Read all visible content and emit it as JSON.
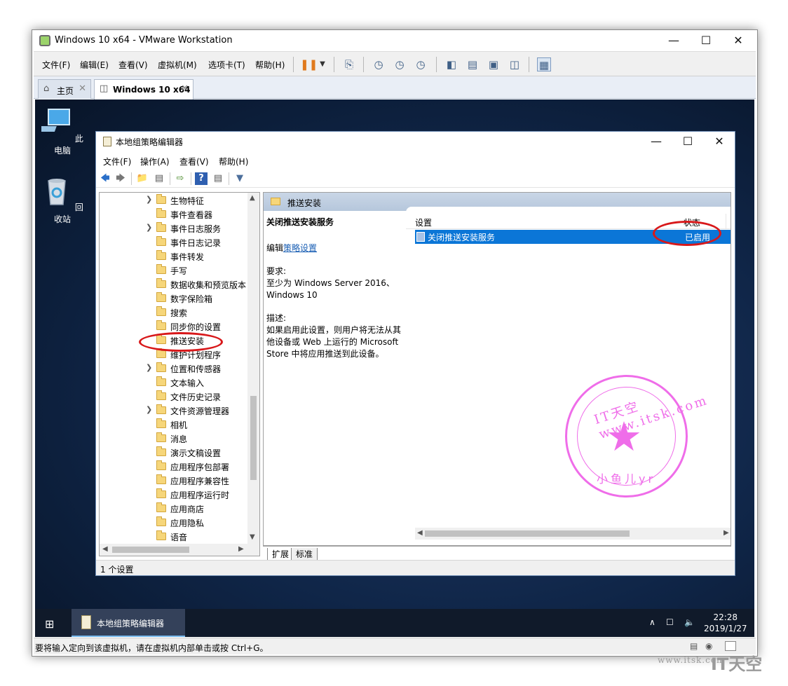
{
  "vmware": {
    "title": "Windows 10 x64 - VMware Workstation",
    "menus": [
      "文件(F)",
      "编辑(E)",
      "查看(V)",
      "虚拟机(M)",
      "选项卡(T)",
      "帮助(H)"
    ],
    "tabs": [
      {
        "label": "主页",
        "icon": "home-icon"
      },
      {
        "label": "Windows 10 x64",
        "icon": "vm-icon"
      }
    ],
    "status_message": "要将输入定向到该虚拟机，请在虚拟机内部单击或按 Ctrl+G。"
  },
  "desktop": {
    "icons": [
      {
        "label": "此电脑",
        "icon": "computer-icon"
      },
      {
        "label": "回收站",
        "icon": "recycle-bin-icon"
      }
    ]
  },
  "gpe": {
    "title": "本地组策略编辑器",
    "menus": [
      "文件(F)",
      "操作(A)",
      "查看(V)",
      "帮助(H)"
    ],
    "tree_items": [
      {
        "label": "生物特征",
        "expandable": true
      },
      {
        "label": "事件查看器",
        "expandable": false
      },
      {
        "label": "事件日志服务",
        "expandable": true
      },
      {
        "label": "事件日志记录",
        "expandable": false
      },
      {
        "label": "事件转发",
        "expandable": false
      },
      {
        "label": "手写",
        "expandable": false
      },
      {
        "label": "数据收集和预览版本",
        "expandable": false
      },
      {
        "label": "数字保险箱",
        "expandable": false
      },
      {
        "label": "搜索",
        "expandable": false
      },
      {
        "label": "同步你的设置",
        "expandable": false
      },
      {
        "label": "推送安装",
        "expandable": false,
        "selected": true
      },
      {
        "label": "维护计划程序",
        "expandable": false
      },
      {
        "label": "位置和传感器",
        "expandable": true
      },
      {
        "label": "文本输入",
        "expandable": false
      },
      {
        "label": "文件历史记录",
        "expandable": false
      },
      {
        "label": "文件资源管理器",
        "expandable": true
      },
      {
        "label": "相机",
        "expandable": false
      },
      {
        "label": "消息",
        "expandable": false
      },
      {
        "label": "演示文稿设置",
        "expandable": false
      },
      {
        "label": "应用程序包部署",
        "expandable": false
      },
      {
        "label": "应用程序兼容性",
        "expandable": false
      },
      {
        "label": "应用程序运行时",
        "expandable": false
      },
      {
        "label": "应用商店",
        "expandable": false
      },
      {
        "label": "应用隐私",
        "expandable": false
      },
      {
        "label": "语音",
        "expandable": false
      }
    ],
    "right_header": "推送安装",
    "desc": {
      "title": "关闭推送安装服务",
      "edit_prefix": "编辑",
      "edit_link": "策略设置",
      "req_label": "要求:",
      "req_text": "至少为 Windows Server 2016、Windows 10",
      "desc_label": "描述:",
      "desc_text": "如果启用此设置，则用户将无法从其他设备或 Web 上运行的 Microsoft Store 中将应用推送到此设备。"
    },
    "list": {
      "col_setting": "设置",
      "col_state": "状态",
      "row_name": "关闭推送安装服务",
      "row_state": "已启用"
    },
    "view_tabs": [
      "扩展",
      "标准"
    ],
    "status": "1 个设置"
  },
  "taskbar": {
    "app_label": "本地组策略编辑器",
    "time": "22:28",
    "date": "2019/1/27"
  },
  "watermark": {
    "stamp_top": "IT天空www.itsk.com",
    "stamp_bottom": "小鱼儿yr",
    "site": "www.itsk.com",
    "brand": "IT天空"
  },
  "colors": {
    "selection": "#0b76d7",
    "annotation_red": "#d8181a",
    "stamp_pink": "#ef6de9",
    "desktop_bg": "#0f2547"
  }
}
